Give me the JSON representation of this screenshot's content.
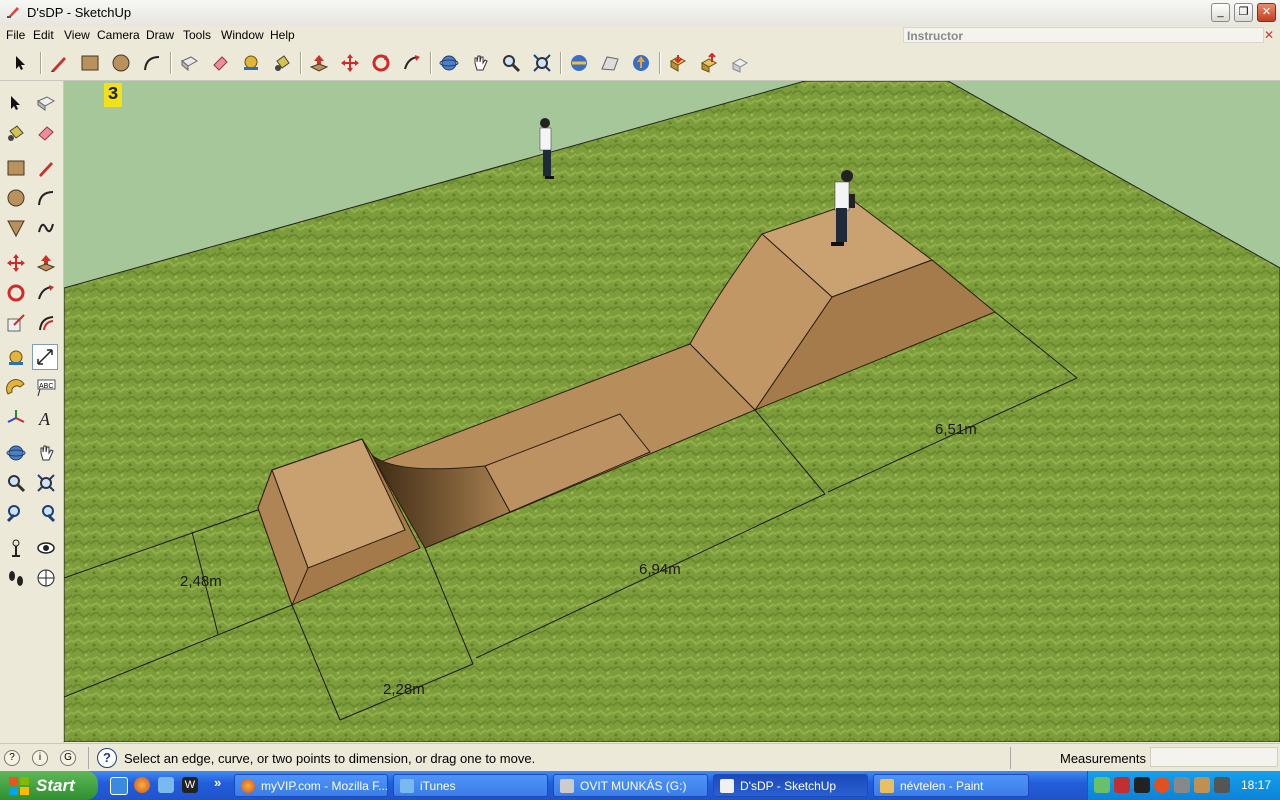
{
  "window": {
    "title": "D'sDP - SketchUp"
  },
  "menu": [
    "File",
    "Edit",
    "View",
    "Camera",
    "Draw",
    "Tools",
    "Window",
    "Help"
  ],
  "instructor": {
    "label": "Instructor"
  },
  "viewport": {
    "badge": "3",
    "dimensions": {
      "d1": "6,51m",
      "d2": "6,94m",
      "d3": "2,48m",
      "d4": "2,28m"
    }
  },
  "status": {
    "message": "Select an edge, curve, or two points to dimension, or drag one to move.",
    "measurements_label": "Measurements",
    "measurements_value": ""
  },
  "taskbar": {
    "start": "Start",
    "tasks": [
      "myVIP.com - Mozilla F...",
      "iTunes",
      "OVIT MUNKÁS (G:)",
      "D'sDP - SketchUp",
      "névtelen - Paint"
    ],
    "clock": "18:17"
  },
  "colors": {
    "grass": "#7e9e3a",
    "sky": "#a6c79a",
    "ramp_top": "#c9a070",
    "ramp_side": "#a67b4b",
    "dimension": "#1a1a1a"
  }
}
